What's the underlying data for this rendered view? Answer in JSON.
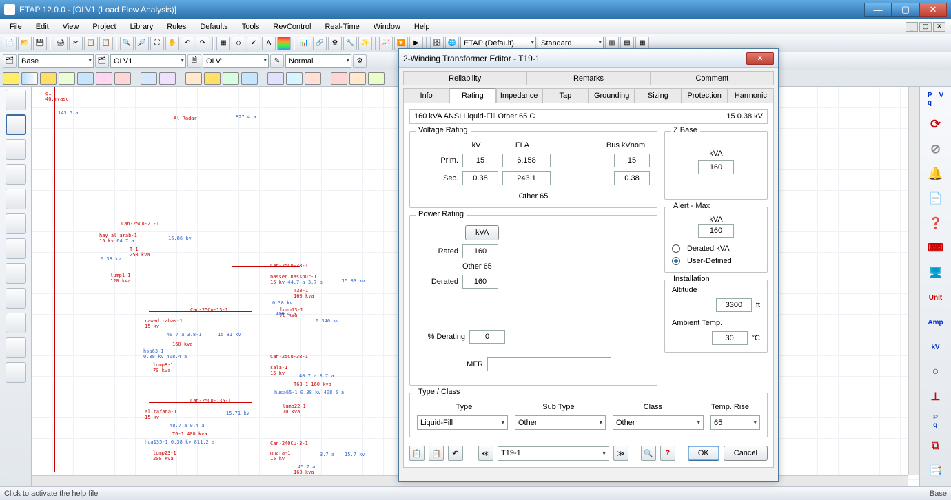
{
  "titlebar": {
    "text": "ETAP 12.0.0  - [OLV1 (Load Flow Analysis)]"
  },
  "menu": [
    "File",
    "Edit",
    "View",
    "Project",
    "Library",
    "Rules",
    "Defaults",
    "Tools",
    "RevControl",
    "Real-Time",
    "Window",
    "Help"
  ],
  "toolbar1": {
    "combo1": "ETAP (Default)",
    "combo2": "Standard"
  },
  "toolbar2": {
    "base": "Base",
    "olv1a": "OLV1",
    "olv1b": "OLV1",
    "mode": "Normal"
  },
  "statusbar": {
    "left": "Click to activate the help file",
    "right": "Base"
  },
  "dialog": {
    "title": "2-Winding Transformer Editor - T19-1",
    "tabs_row1": [
      "Reliability",
      "Remarks",
      "Comment"
    ],
    "tabs_row2": [
      "Info",
      "Rating",
      "Impedance",
      "Tap",
      "Grounding",
      "Sizing",
      "Protection",
      "Harmonic"
    ],
    "active_tab": "Rating",
    "summary_left": "160 kVA   ANSI   Liquid-Fill   Other   65 C",
    "summary_right": "15      0.38 kV",
    "voltage": {
      "title": "Voltage Rating",
      "hdr_kv": "kV",
      "hdr_fla": "FLA",
      "hdr_bus": "Bus kVnom",
      "prim_lbl": "Prim.",
      "prim_kv": "15",
      "prim_fla": "6.158",
      "prim_bus": "15",
      "sec_lbl": "Sec.",
      "sec_kv": "0.38",
      "sec_fla": "243.1",
      "sec_bus": "0.38",
      "other": "Other 65"
    },
    "power": {
      "title": "Power Rating",
      "kva_btn": "kVA",
      "rated_lbl": "Rated",
      "rated": "160",
      "other": "Other 65",
      "derated_lbl": "Derated",
      "derated": "160",
      "pct_lbl": "% Derating",
      "pct": "0",
      "mfr_lbl": "MFR",
      "mfr": ""
    },
    "zbase": {
      "title": "Z Base",
      "kva_lbl": "kVA",
      "kva": "160"
    },
    "alert": {
      "title": "Alert - Max",
      "kva_lbl": "kVA",
      "kva": "160",
      "opt_derated": "Derated kVA",
      "opt_user": "User-Defined",
      "checked": "user"
    },
    "install": {
      "title": "Installation",
      "alt_lbl": "Altitude",
      "alt": "3300",
      "alt_u": "ft",
      "amb_lbl": "Ambient Temp.",
      "amb": "30",
      "amb_u": "°C"
    },
    "typeclass": {
      "title": "Type / Class",
      "type_lbl": "Type",
      "type": "Liquid-Fill",
      "sub_lbl": "Sub Type",
      "sub": "Other",
      "class_lbl": "Class",
      "class": "Other",
      "temp_lbl": "Temp. Rise",
      "temp": "65"
    },
    "nav": {
      "id": "T19-1"
    },
    "btn_ok": "OK",
    "btn_cancel": "Cancel"
  },
  "right_labels": {
    "unit": "Unit",
    "amp": "Amp",
    "kv": "kV"
  }
}
